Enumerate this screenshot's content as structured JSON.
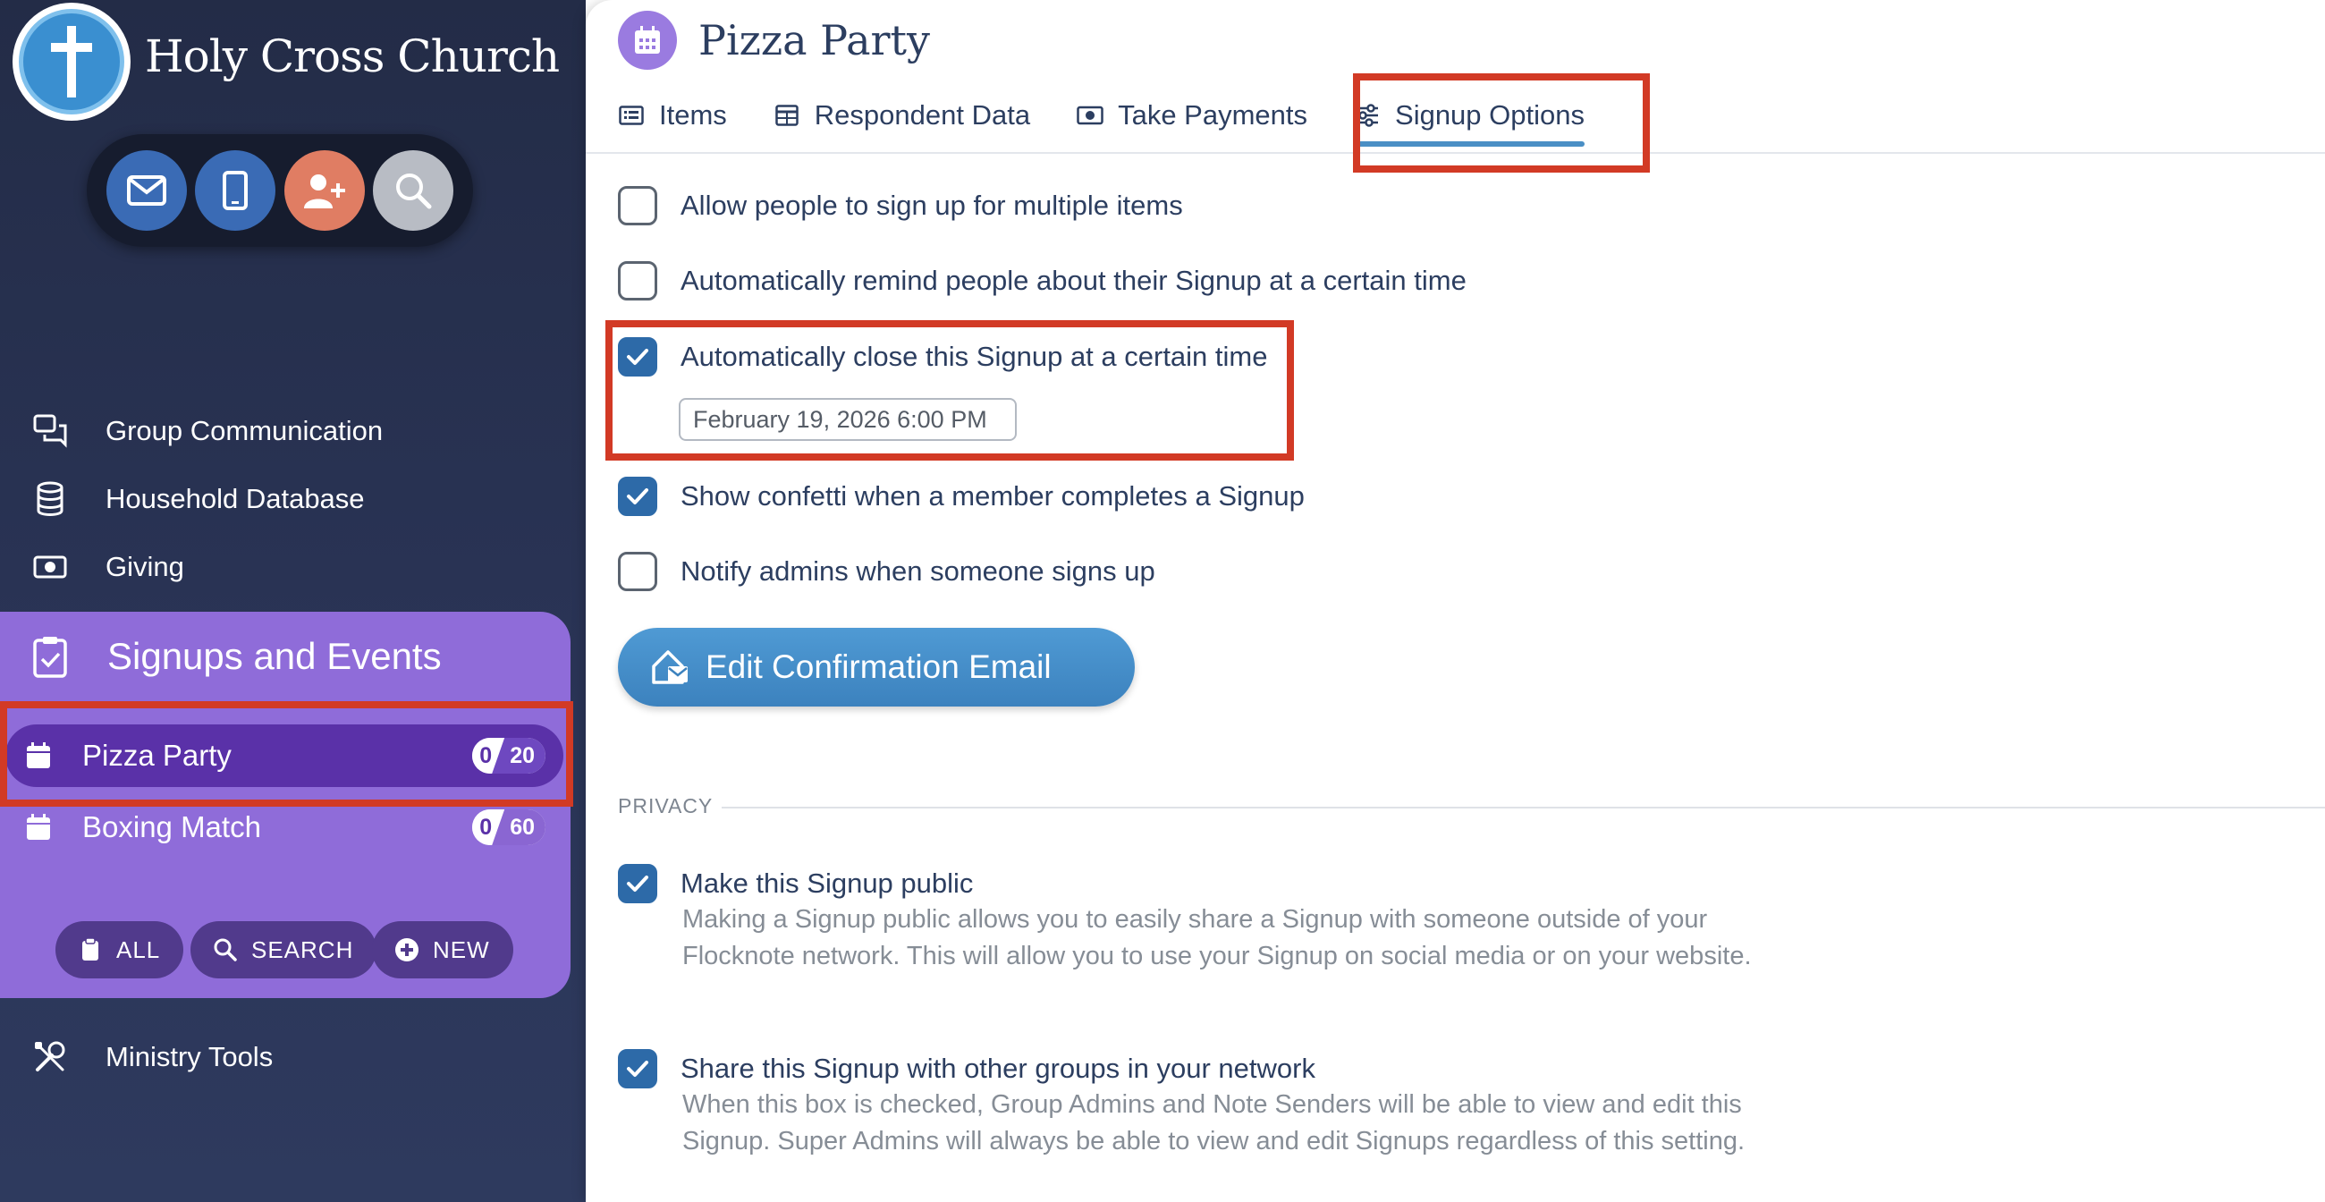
{
  "sidebar": {
    "church_name": "Holy Cross Church",
    "quick_actions": [
      "email-icon",
      "phone-icon",
      "add-person-icon",
      "search-icon"
    ],
    "nav": {
      "group_communication": "Group Communication",
      "household_database": "Household Database",
      "giving": "Giving",
      "ministry_tools": "Ministry Tools"
    },
    "signups": {
      "title": "Signups and Events",
      "items": [
        {
          "name": "Pizza Party",
          "filled": "0",
          "total": "20",
          "active": true
        },
        {
          "name": "Boxing Match",
          "filled": "0",
          "total": "60",
          "active": false
        }
      ],
      "buttons": {
        "all": "ALL",
        "search": "SEARCH",
        "new": "NEW"
      }
    }
  },
  "main": {
    "title": "Pizza Party",
    "tabs": [
      {
        "label": "Items",
        "icon": "list-icon"
      },
      {
        "label": "Respondent Data",
        "icon": "table-icon"
      },
      {
        "label": "Take Payments",
        "icon": "money-icon"
      },
      {
        "label": "Signup Options",
        "icon": "sliders-icon",
        "active": true
      }
    ],
    "options": {
      "multiple_items": {
        "label": "Allow people to sign up for multiple items",
        "checked": false
      },
      "auto_remind": {
        "label": "Automatically remind people about their Signup at a certain time",
        "checked": false
      },
      "auto_close": {
        "label": "Automatically close this Signup at a certain time",
        "checked": true,
        "value": "February 19, 2026 6:00 PM"
      },
      "confetti": {
        "label": "Show confetti when a member completes a Signup",
        "checked": true
      },
      "notify_admins": {
        "label": "Notify admins when someone signs up",
        "checked": false
      }
    },
    "edit_email_button": "Edit Confirmation Email",
    "privacy": {
      "heading": "PRIVACY",
      "make_public": {
        "label": "Make this Signup public",
        "desc": "Making a Signup public allows you to easily share a Signup with someone outside of your Flocknote network. This will allow you to use your Signup on social media or on your website.",
        "checked": true
      },
      "share_groups": {
        "label": "Share this Signup with other groups in your network",
        "desc": "When this box is checked, Group Admins and Note Senders will be able to view and edit this Signup. Super Admins will always be able to view and edit Signups regardless of this setting.",
        "checked": true
      }
    }
  },
  "colors": {
    "highlight": "#d23a25",
    "accent": "#4a8fc5",
    "sidebar_purple": "#8f6cd9",
    "active_purple": "#5a31a8"
  }
}
